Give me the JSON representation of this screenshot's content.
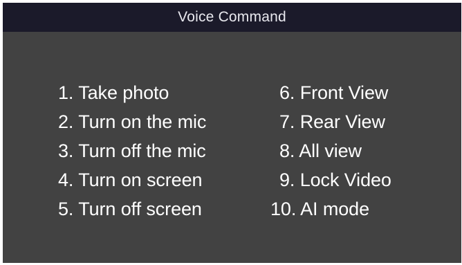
{
  "header": {
    "title": "Voice Command"
  },
  "commands": [
    "1. Take photo",
    "2. Turn on the mic",
    "3. Turn off the mic",
    "4. Turn on screen",
    "5. Turn off screen",
    "6. Front View",
    "7. Rear View",
    "8. All view",
    "9. Lock Video",
    "10. AI mode"
  ],
  "colors": {
    "background": "#424242",
    "title_bar": "#1b1a2a",
    "text": "#ffffff"
  }
}
